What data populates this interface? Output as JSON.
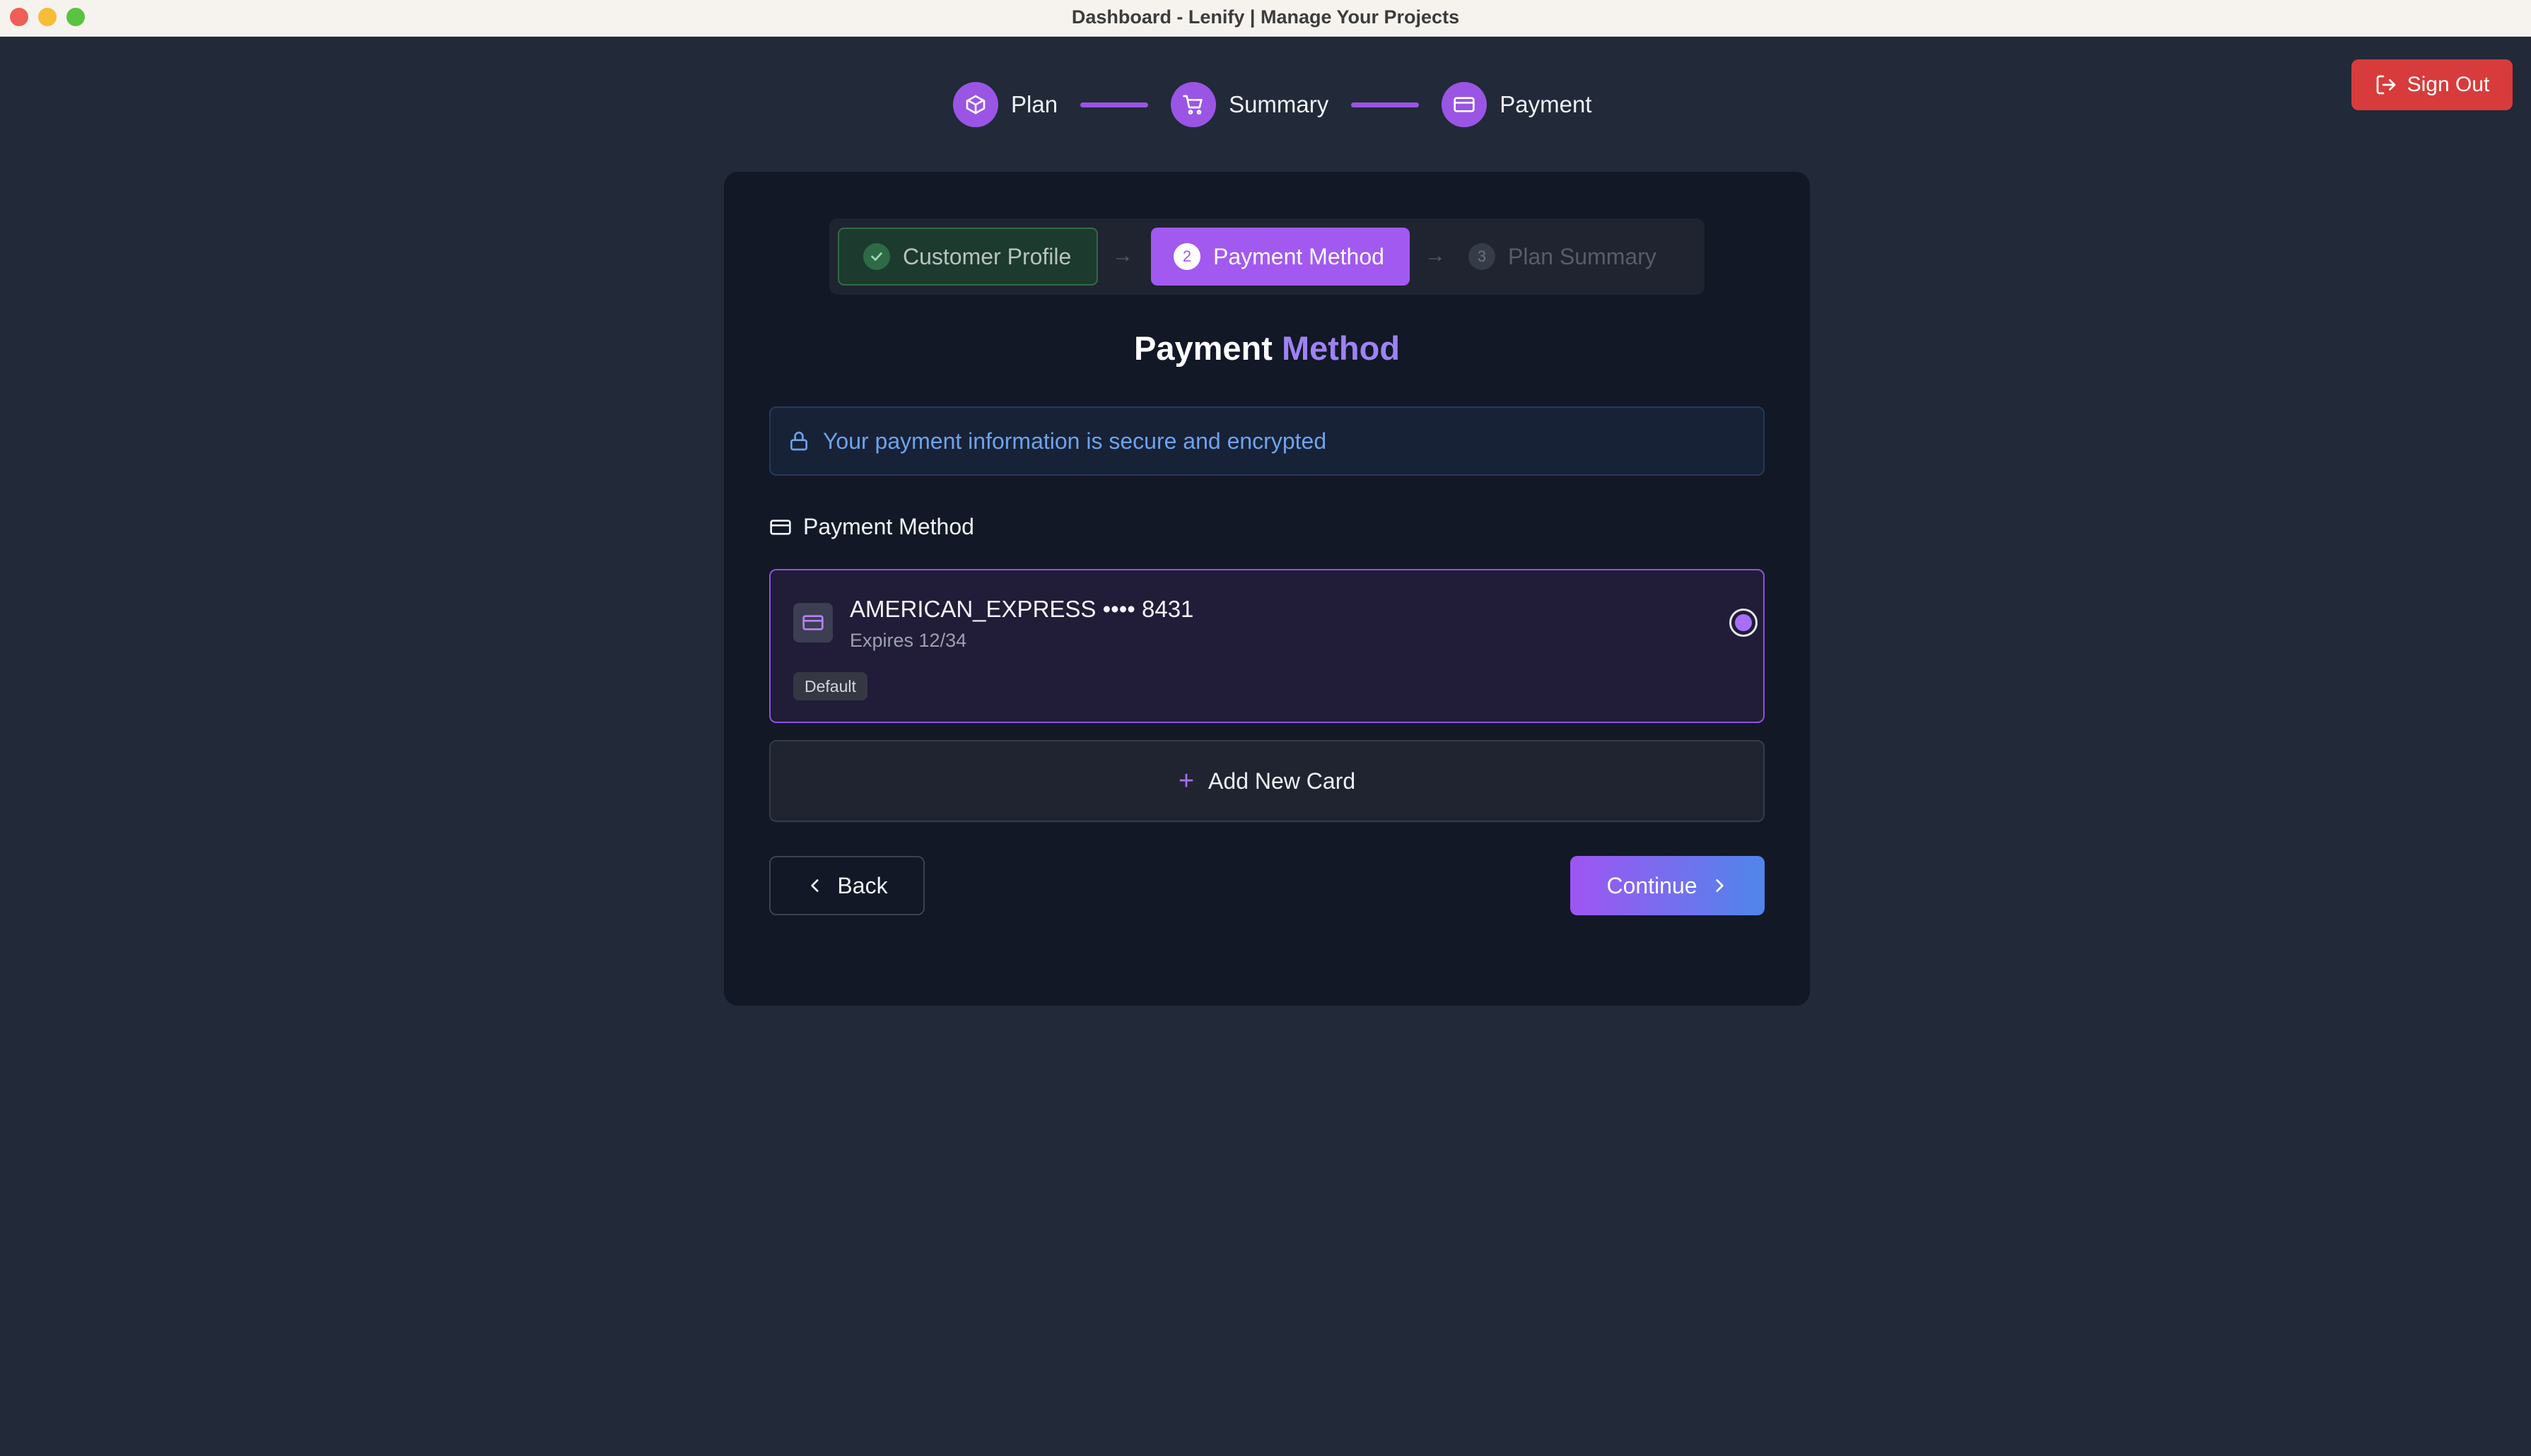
{
  "window": {
    "title": "Dashboard - Lenify | Manage Your Projects"
  },
  "header": {
    "sign_out_label": "Sign Out"
  },
  "stepper": [
    {
      "label": "Plan",
      "icon": "box-icon"
    },
    {
      "label": "Summary",
      "icon": "cart-icon"
    },
    {
      "label": "Payment",
      "icon": "credit-card-icon"
    }
  ],
  "substeps": {
    "done": {
      "label": "Customer Profile"
    },
    "active": {
      "number": "2",
      "label": "Payment Method"
    },
    "next": {
      "number": "3",
      "label": "Plan Summary"
    }
  },
  "page": {
    "title_main": "Payment",
    "title_accent": "Method",
    "secure_notice": "Your payment information is secure and encrypted",
    "section_title": "Payment Method"
  },
  "payment_method": {
    "name": "AMERICAN_EXPRESS •••• 8431",
    "expires": "Expires 12/34",
    "badge": "Default",
    "selected": true
  },
  "actions": {
    "add_card": "Add New Card",
    "back": "Back",
    "continue": "Continue"
  },
  "colors": {
    "accent": "#a259f0",
    "danger": "#d83b3b",
    "success": "#2e6a45",
    "info": "#6fa2ea"
  }
}
